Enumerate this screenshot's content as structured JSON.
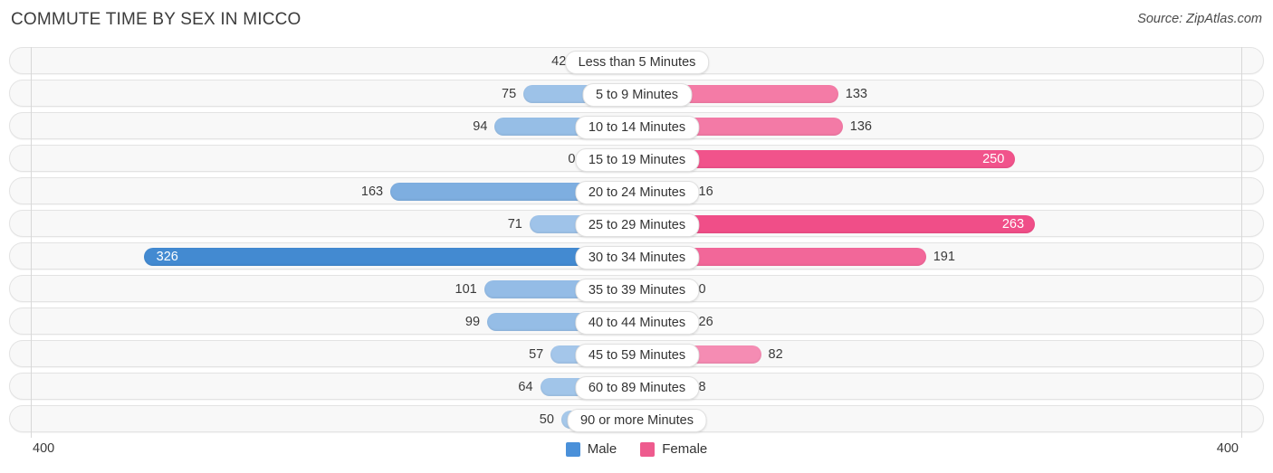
{
  "header": {
    "title": "COMMUTE TIME BY SEX IN MICCO",
    "source": "Source: ZipAtlas.com"
  },
  "legend": {
    "male_label": "Male",
    "female_label": "Female",
    "male_color": "#4a90d9",
    "female_color": "#ee5b8e"
  },
  "axis": {
    "left_tick": "400",
    "right_tick": "400",
    "max": 400
  },
  "chart_data": {
    "type": "bar",
    "orientation": "horizontal-diverging",
    "title": "COMMUTE TIME BY SEX IN MICCO",
    "xlabel": "",
    "ylabel": "",
    "xlim": [
      400,
      400
    ],
    "grid": false,
    "legend_position": "bottom-center",
    "categories": [
      "Less than 5 Minutes",
      "5 to 9 Minutes",
      "10 to 14 Minutes",
      "15 to 19 Minutes",
      "20 to 24 Minutes",
      "25 to 29 Minutes",
      "30 to 34 Minutes",
      "35 to 39 Minutes",
      "40 to 44 Minutes",
      "45 to 59 Minutes",
      "60 to 89 Minutes",
      "90 or more Minutes"
    ],
    "series": [
      {
        "name": "Male",
        "values": [
          42,
          75,
          94,
          0,
          163,
          71,
          326,
          101,
          99,
          57,
          64,
          50
        ]
      },
      {
        "name": "Female",
        "values": [
          0,
          133,
          136,
          250,
          16,
          263,
          191,
          0,
          26,
          82,
          8,
          0
        ]
      }
    ]
  },
  "rows": [
    {
      "label": "Less than 5 Minutes",
      "male": "42",
      "female": "0",
      "male_val": 42,
      "female_val": 0
    },
    {
      "label": "5 to 9 Minutes",
      "male": "75",
      "female": "133",
      "male_val": 75,
      "female_val": 133
    },
    {
      "label": "10 to 14 Minutes",
      "male": "94",
      "female": "136",
      "male_val": 94,
      "female_val": 136
    },
    {
      "label": "15 to 19 Minutes",
      "male": "0",
      "female": "250",
      "male_val": 0,
      "female_val": 250
    },
    {
      "label": "20 to 24 Minutes",
      "male": "163",
      "female": "16",
      "male_val": 163,
      "female_val": 16
    },
    {
      "label": "25 to 29 Minutes",
      "male": "71",
      "female": "263",
      "male_val": 71,
      "female_val": 263
    },
    {
      "label": "30 to 34 Minutes",
      "male": "326",
      "female": "191",
      "male_val": 326,
      "female_val": 191
    },
    {
      "label": "35 to 39 Minutes",
      "male": "101",
      "female": "0",
      "male_val": 101,
      "female_val": 0
    },
    {
      "label": "40 to 44 Minutes",
      "male": "99",
      "female": "26",
      "male_val": 99,
      "female_val": 26
    },
    {
      "label": "45 to 59 Minutes",
      "male": "57",
      "female": "82",
      "male_val": 57,
      "female_val": 82
    },
    {
      "label": "60 to 89 Minutes",
      "male": "64",
      "female": "8",
      "male_val": 64,
      "female_val": 8
    },
    {
      "label": "90 or more Minutes",
      "male": "50",
      "female": "0",
      "male_val": 50,
      "female_val": 0
    }
  ]
}
